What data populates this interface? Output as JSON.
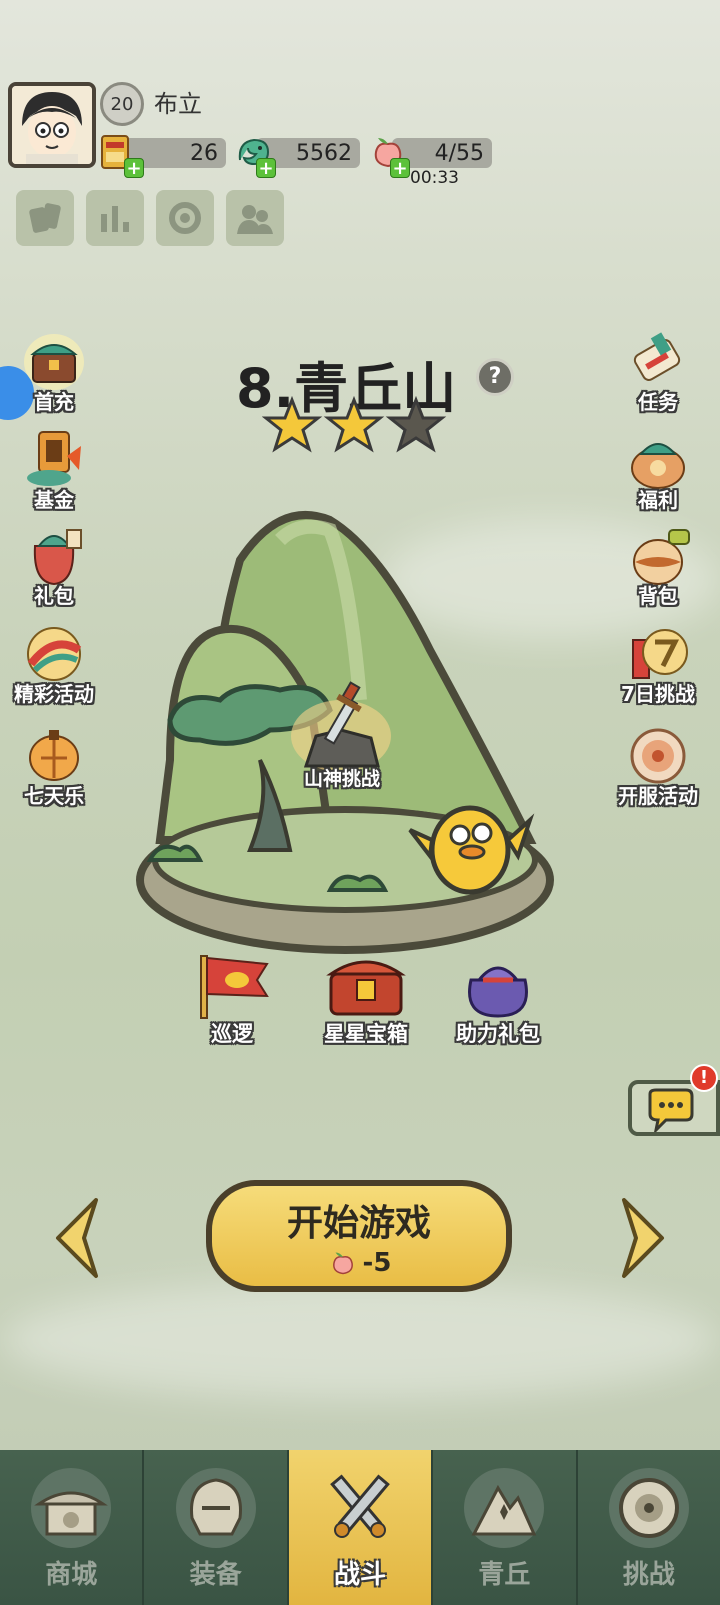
{
  "player": {
    "level": "20",
    "name": "布立"
  },
  "resources": {
    "coupon": "26",
    "jade": "5562",
    "stamina": "4/55",
    "stamina_timer": "00:33"
  },
  "tools": [
    "cards-icon",
    "stats-icon",
    "settings-icon",
    "friends-icon"
  ],
  "left_menu": [
    {
      "label": "首充",
      "icon": "first-recharge-chest-icon"
    },
    {
      "label": "基金",
      "icon": "fund-icon"
    },
    {
      "label": "礼包",
      "icon": "gift-bag-icon"
    },
    {
      "label": "精彩活动",
      "icon": "events-icon"
    },
    {
      "label": "七天乐",
      "icon": "seven-day-icon"
    }
  ],
  "right_menu": [
    {
      "label": "任务",
      "icon": "quest-scroll-icon"
    },
    {
      "label": "福利",
      "icon": "welfare-icon"
    },
    {
      "label": "背包",
      "icon": "backpack-icon"
    },
    {
      "label": "7日挑战",
      "icon": "seven-day-challenge-icon"
    },
    {
      "label": "开服活动",
      "icon": "server-event-icon"
    }
  ],
  "level": {
    "title": "8.青丘山",
    "stars_earned": 2,
    "stars_total": 3,
    "boss_label": "山神挑战"
  },
  "stage_actions": [
    {
      "label": "巡逻",
      "icon": "patrol-flag-icon"
    },
    {
      "label": "星星宝箱",
      "icon": "star-chest-icon"
    },
    {
      "label": "助力礼包",
      "icon": "support-gift-icon"
    }
  ],
  "chat": {
    "badge": "!"
  },
  "start_button": {
    "label": "开始游戏",
    "cost": "-5"
  },
  "bottom_nav": [
    {
      "label": "商城",
      "active": false
    },
    {
      "label": "装备",
      "active": false
    },
    {
      "label": "战斗",
      "active": true
    },
    {
      "label": "青丘",
      "active": false
    },
    {
      "label": "挑战",
      "active": false
    }
  ]
}
